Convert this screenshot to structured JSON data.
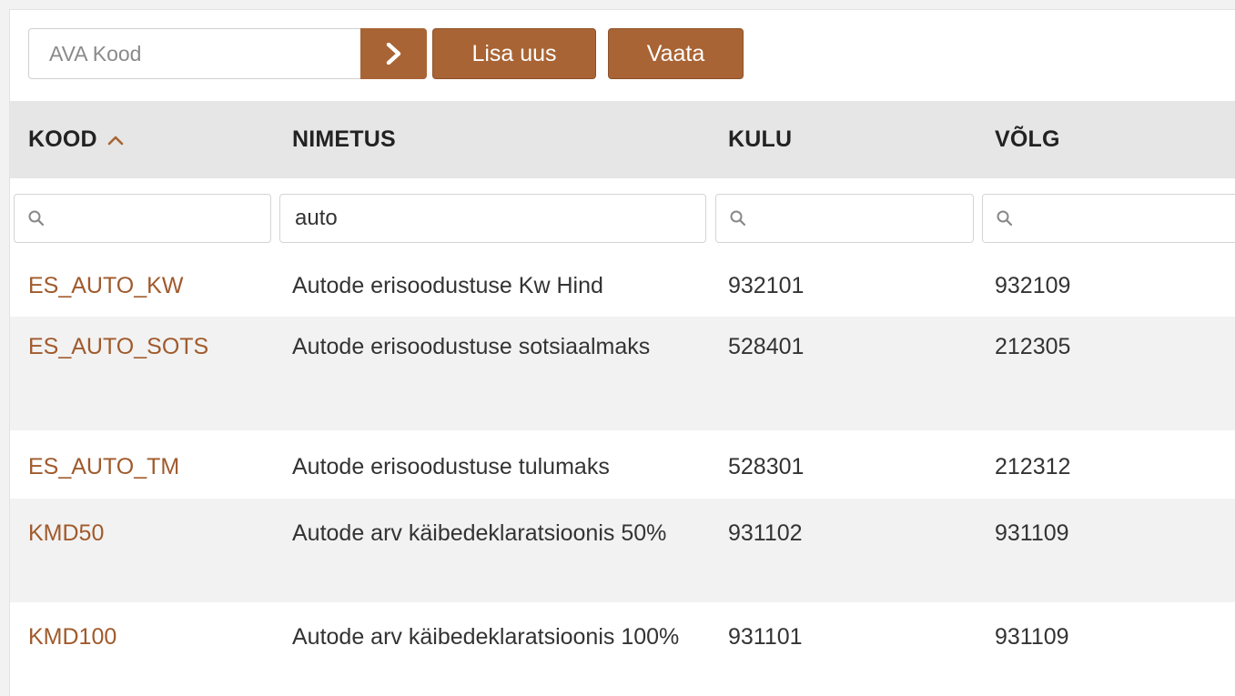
{
  "toolbar": {
    "code_placeholder": "AVA Kood",
    "go_icon": "chevron-right-icon",
    "add_label": "Lisa uus",
    "view_label": "Vaata"
  },
  "colors": {
    "accent": "#a86434",
    "link": "#a05a2c",
    "header_bg": "#e6e6e6",
    "alt_row_bg": "#f2f2f2"
  },
  "table": {
    "columns": [
      {
        "label": "KOOD",
        "sort": "ascending",
        "sort_icon": "chevron-up-icon"
      },
      {
        "label": "NIMETUS"
      },
      {
        "label": "KULU"
      },
      {
        "label": "VÕLG"
      }
    ],
    "filters": [
      "",
      "auto",
      "",
      ""
    ],
    "filter_icon": "search-icon",
    "rows": [
      {
        "code": "ES_AUTO_KW",
        "name": "Autode erisoodustuse Kw Hind",
        "kulu": "932101",
        "volg": "932109"
      },
      {
        "code": "ES_AUTO_SOTS",
        "name": "Autode erisoodustuse sotsiaalmaks",
        "kulu": "528401",
        "volg": "212305"
      },
      {
        "code": "ES_AUTO_TM",
        "name": "Autode erisoodustuse tulumaks",
        "kulu": "528301",
        "volg": "212312"
      },
      {
        "code": "KMD50",
        "name": "Autode arv käibedeklaratsioonis 50%",
        "kulu": "931102",
        "volg": "931109"
      },
      {
        "code": "KMD100",
        "name": "Autode arv käibedeklaratsioonis 100%",
        "kulu": "931101",
        "volg": "931109"
      }
    ]
  }
}
